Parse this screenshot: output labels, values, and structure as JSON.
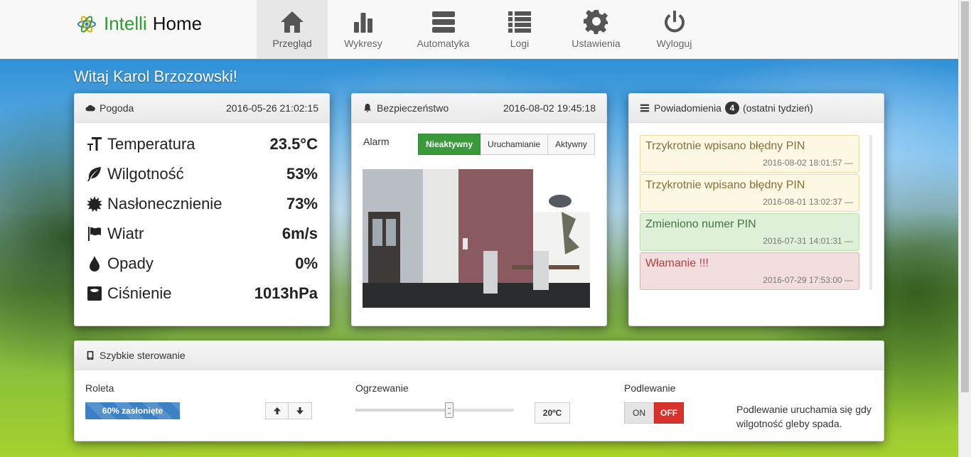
{
  "brand": {
    "part1": "Intelli",
    "part2": "Home"
  },
  "nav": [
    {
      "label": "Przegląd",
      "icon": "home-icon",
      "active": true
    },
    {
      "label": "Wykresy",
      "icon": "bar-chart-icon"
    },
    {
      "label": "Automatyka",
      "icon": "server-icon"
    },
    {
      "label": "Logi",
      "icon": "list-icon"
    },
    {
      "label": "Ustawienia",
      "icon": "gear-icon"
    },
    {
      "label": "Wyloguj",
      "icon": "power-icon"
    }
  ],
  "welcome": "Witaj Karol Brzozowski!",
  "weather": {
    "title": "Pogoda",
    "timestamp": "2016-05-26 21:02:15",
    "rows": [
      {
        "label": "Temperatura",
        "value": "23.5°C",
        "icon": "temperature-icon"
      },
      {
        "label": "Wilgotność",
        "value": "53%",
        "icon": "leaf-icon"
      },
      {
        "label": "Nasłonecznienie",
        "value": "73%",
        "icon": "sun-icon"
      },
      {
        "label": "Wiatr",
        "value": "6m/s",
        "icon": "flag-icon"
      },
      {
        "label": "Opady",
        "value": "0%",
        "icon": "drop-icon"
      },
      {
        "label": "Ciśnienie",
        "value": "1013hPa",
        "icon": "scale-icon"
      }
    ]
  },
  "security": {
    "title": "Bezpieczeństwo",
    "timestamp": "2016-08-02 19:45:18",
    "alarm_label": "Alarm",
    "alarm_options": [
      "Nieaktywny",
      "Uruchamianie",
      "Aktywny"
    ],
    "alarm_selected": "Nieaktywny"
  },
  "notifications": {
    "title": "Powiadomienia",
    "count": "4",
    "period": "(ostatni tydzień)",
    "items": [
      {
        "text": "Trzykrotnie wpisano błędny PIN",
        "time": "2016-08-02 18:01:57 —",
        "level": "warning"
      },
      {
        "text": "Trzykrotnie wpisano błędny PIN",
        "time": "2016-08-01 13:02:37 —",
        "level": "warning"
      },
      {
        "text": "Zmieniono numer PIN",
        "time": "2016-07-31 14:01:31 —",
        "level": "success"
      },
      {
        "text": "Włamanie !!!",
        "time": "2016-07-29 17:53:00 —",
        "level": "danger"
      }
    ]
  },
  "quick": {
    "title": "Szybkie sterowanie",
    "blind": {
      "label": "Roleta",
      "progress_text": "60% zasłonięte",
      "progress": 100
    },
    "heating": {
      "label": "Ogrzewanie",
      "value": "20ºC",
      "slider_fraction": 0.59
    },
    "watering": {
      "label": "Podlewanie",
      "on_label": "ON",
      "off_label": "OFF",
      "note": "Podlewanie uruchamia się gdy wilgotność gleby spada."
    }
  },
  "colors": {
    "brand_green": "#2e9b2e",
    "alarm_active": "#3a9a3a",
    "progress_blue": "#3b7fc4",
    "off_red": "#d9312b"
  }
}
